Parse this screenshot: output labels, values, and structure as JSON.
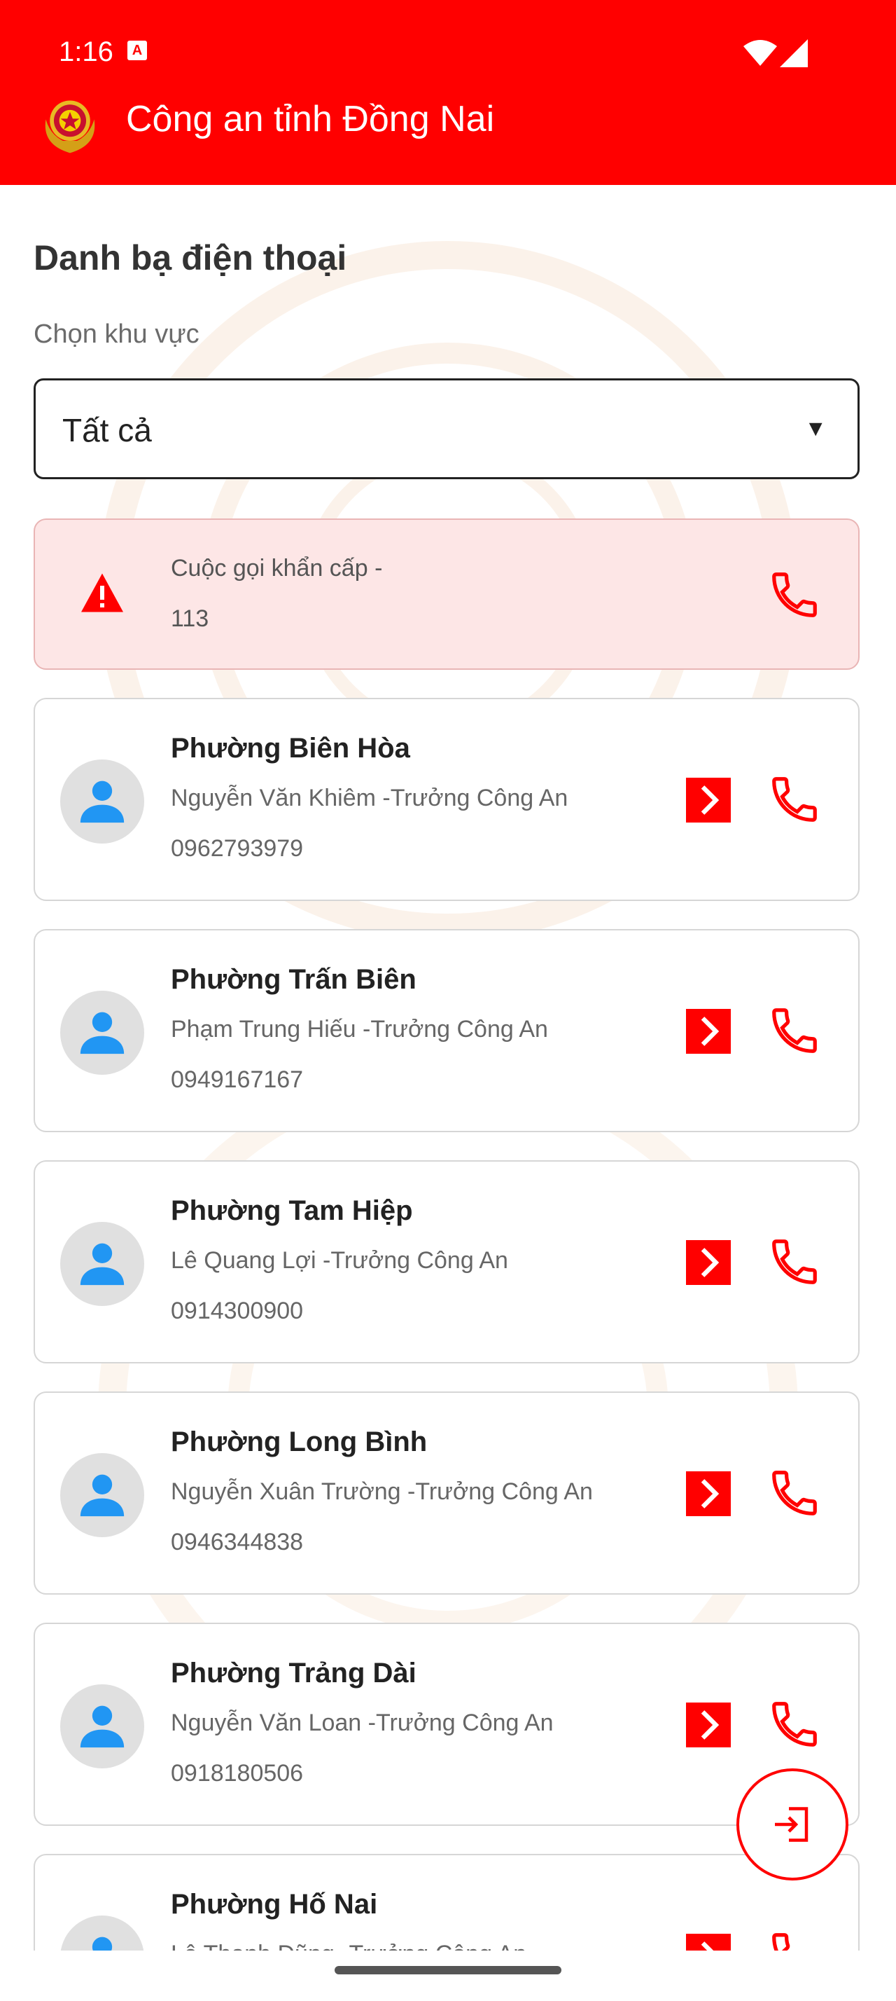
{
  "status_bar": {
    "time": "1:16",
    "badge": "A"
  },
  "app_bar": {
    "title": "Công an tỉnh Đồng Nai",
    "logo_icon": "police-emblem-icon"
  },
  "page": {
    "title": "Danh bạ điện thoại",
    "area_label": "Chọn khu vực",
    "area_select": {
      "value": "Tất cả",
      "arrow": "▼"
    }
  },
  "emergency": {
    "line1": "Cuộc gọi khẩn cấp -",
    "line2": "113"
  },
  "contacts": [
    {
      "ward": "Phường Biên Hòa",
      "name": "Nguyễn Văn Khiêm -Trưởng Công An",
      "phone": "0962793979"
    },
    {
      "ward": "Phường Trấn Biên",
      "name": "Phạm Trung Hiếu -Trưởng Công An",
      "phone": "0949167167"
    },
    {
      "ward": "Phường Tam Hiệp",
      "name": "Lê Quang Lợi -Trưởng Công An",
      "phone": "0914300900"
    },
    {
      "ward": "Phường Long Bình",
      "name": "Nguyễn Xuân Trường -Trưởng Công An",
      "phone": "0946344838"
    },
    {
      "ward": "Phường Trảng Dài",
      "name": "Nguyễn Văn Loan -Trưởng Công An",
      "phone": "0918180506"
    },
    {
      "ward": "Phường Hố Nai",
      "name": "Lê Thanh Dũng -Trưởng Công An",
      "phone": ""
    }
  ],
  "colors": {
    "primary": "#ff0000",
    "emergency_bg": "#fde6e6",
    "avatar_icon": "#2196f3"
  }
}
